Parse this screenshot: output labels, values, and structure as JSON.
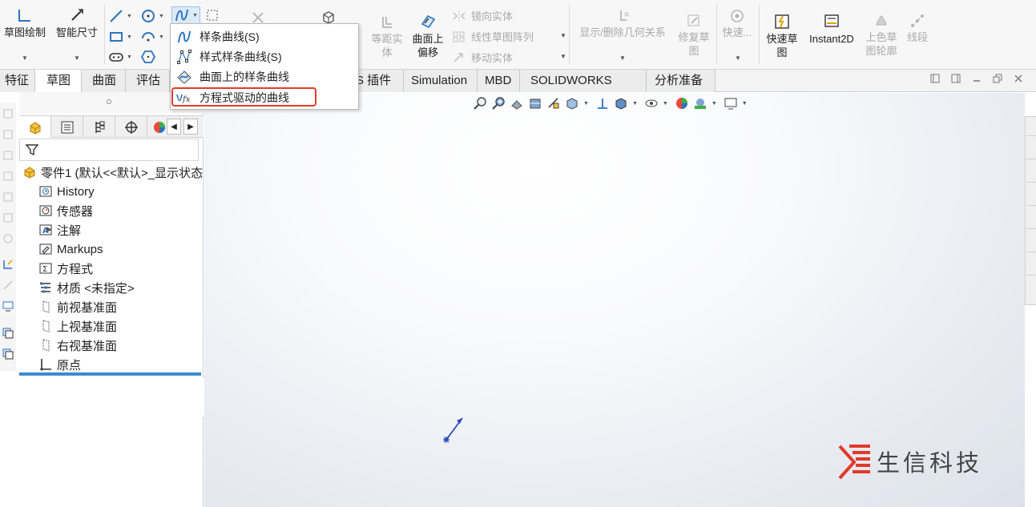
{
  "ribbon": {
    "sketch_label": "草图绘制",
    "smart_dim_label": "智能尺寸",
    "offset_entities_line1": "等距实",
    "offset_entities_line2": "体",
    "surface_offset_line1": "曲面上",
    "surface_offset_line2": "偏移",
    "mirror_label": "镜向实体",
    "linear_pattern_label": "线性草图阵列",
    "move_label": "移动实体",
    "display_relations_label": "显示/删除几何关系",
    "repair_line1": "修复草",
    "repair_line2": "图",
    "quick_snap_label": "快速...",
    "rapid_sketch_line1": "快速草",
    "rapid_sketch_line2": "图",
    "instant2d_label": "Instant2D",
    "shaded_line1": "上色草",
    "shaded_line2": "图轮廓",
    "segment_label": "线段"
  },
  "tabs": [
    {
      "label": "特征"
    },
    {
      "label": "草图"
    },
    {
      "label": "曲面"
    },
    {
      "label": "评估"
    },
    {
      "label": "S 插件"
    },
    {
      "label": "Simulation"
    },
    {
      "label": "MBD"
    },
    {
      "label": "SOLIDWORKS CAM"
    },
    {
      "label": "分析准备"
    }
  ],
  "spline_menu": {
    "items": [
      {
        "label": "样条曲线(S)",
        "icon": "spline-icon"
      },
      {
        "label": "样式样条曲线(S)",
        "icon": "style-spline-icon"
      },
      {
        "label": "曲面上的样条曲线",
        "icon": "spline-on-surface-icon"
      },
      {
        "label": "方程式驱动的曲线",
        "icon": "equation-curve-icon"
      }
    ]
  },
  "feature_tree": {
    "root": "零件1 (默认<<默认>_显示状态",
    "items": [
      {
        "label": "History",
        "icon": "history-icon"
      },
      {
        "label": "传感器",
        "icon": "sensor-icon"
      },
      {
        "label": "注解",
        "icon": "annotation-icon"
      },
      {
        "label": "Markups",
        "icon": "markups-icon"
      },
      {
        "label": "方程式",
        "icon": "equations-icon"
      },
      {
        "label": "材质 <未指定>",
        "icon": "material-icon"
      },
      {
        "label": "前视基准面",
        "icon": "plane-icon"
      },
      {
        "label": "上视基准面",
        "icon": "plane-icon"
      },
      {
        "label": "右视基准面",
        "icon": "plane-icon"
      },
      {
        "label": "原点",
        "icon": "origin-icon"
      }
    ]
  },
  "watermark": {
    "text": "生信科技"
  },
  "colors": {
    "highlight": "#e23b2e",
    "accent": "#3b8ad1"
  }
}
